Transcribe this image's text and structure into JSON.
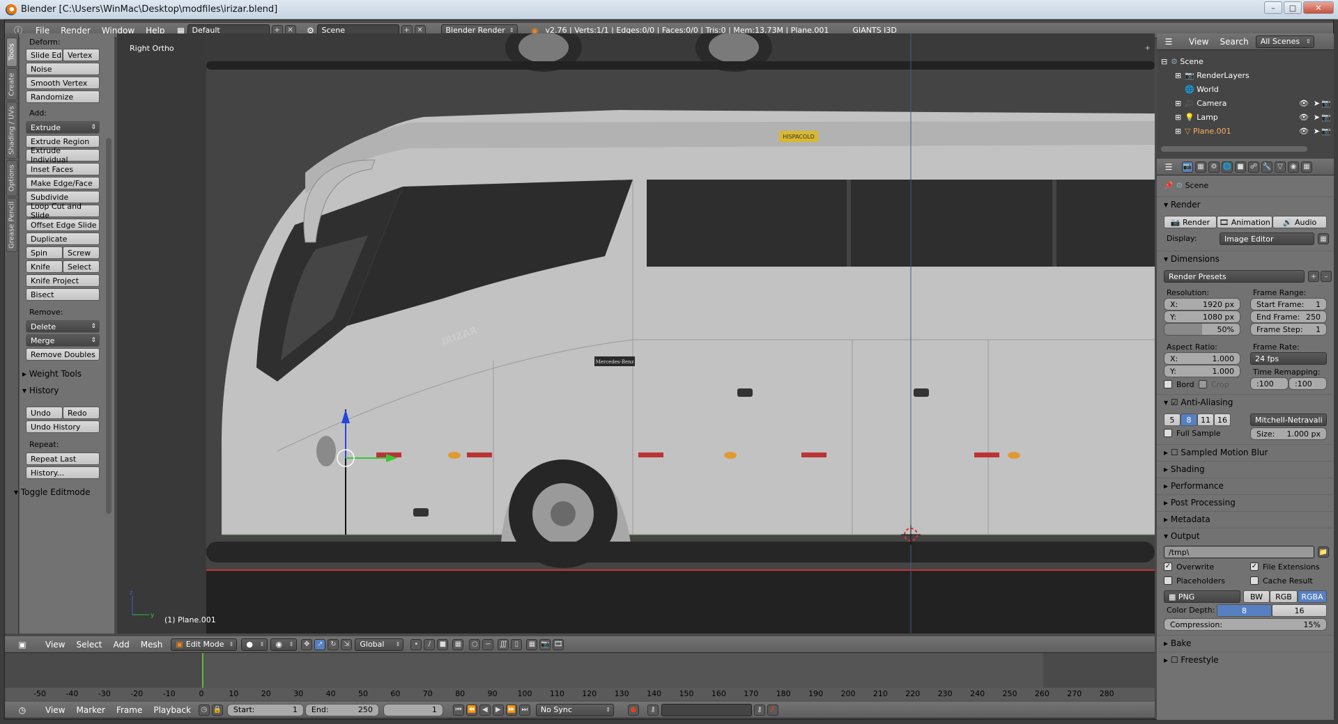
{
  "window": {
    "title": "Blender [C:\\Users\\WinMac\\Desktop\\modfiles\\irizar.blend]"
  },
  "topbar": {
    "menus": [
      "File",
      "Render",
      "Window",
      "Help"
    ],
    "screen_layout": "Default",
    "scene": "Scene",
    "engine": "Blender Render",
    "stats": "v2.76 | Verts:1/1 | Edges:0/0 | Faces:0/0 | Tris:0 | Mem:13.73M | Plane.001",
    "addon": "GIANTS I3D"
  },
  "toolshelf": {
    "tabs": [
      "Tools",
      "Create",
      "Shading / UVs",
      "Options",
      "Grease Pencil"
    ],
    "deform_label": "Deform:",
    "deform": [
      "Slide Ed",
      "Vertex",
      "Noise",
      "Smooth Vertex",
      "Randomize"
    ],
    "add_label": "Add:",
    "extrude": "Extrude",
    "add": [
      "Extrude Region",
      "Extrude Individual",
      "Inset Faces",
      "Make Edge/Face",
      "Subdivide",
      "Loop Cut and Slide",
      "Offset Edge Slide",
      "Duplicate"
    ],
    "spin": "Spin",
    "screw": "Screw",
    "knife": "Knife",
    "select": "Select",
    "knife_project": "Knife Project",
    "bisect": "Bisect",
    "remove_label": "Remove:",
    "delete": "Delete",
    "merge": "Merge",
    "remove_doubles": "Remove Doubles",
    "weight_tools": "Weight Tools",
    "history": "History",
    "undo": "Undo",
    "redo": "Redo",
    "undo_history": "Undo History",
    "repeat_label": "Repeat:",
    "repeat_last": "Repeat Last",
    "history_dots": "History...",
    "toggle_editmode": "Toggle Editmode"
  },
  "viewport": {
    "view_name": "Right Ortho",
    "object_label": "(1) Plane.001",
    "decal_brand": "IRIZAR",
    "badge_text": "Mercedes-Benz",
    "plate_text": "HISPACOLD",
    "colors": {
      "body": "#c2c2c2",
      "window": "#2e2e2e",
      "bg": "#393939"
    }
  },
  "view3d_header": {
    "menus": [
      "View",
      "Select",
      "Add",
      "Mesh"
    ],
    "mode": "Edit Mode",
    "orientation": "Global"
  },
  "timeline": {
    "ticks": [
      "-50",
      "-40",
      "-30",
      "-20",
      "-10",
      "0",
      "10",
      "20",
      "30",
      "40",
      "50",
      "60",
      "70",
      "80",
      "90",
      "100",
      "110",
      "120",
      "130",
      "140",
      "150",
      "160",
      "170",
      "180",
      "190",
      "200",
      "210",
      "220",
      "230",
      "240",
      "250",
      "260",
      "270",
      "280"
    ],
    "current_frame": "0",
    "menus": [
      "View",
      "Marker",
      "Frame",
      "Playback"
    ],
    "start_label": "Start:",
    "start": "1",
    "end_label": "End:",
    "end": "250",
    "frame": "1",
    "sync": "No Sync"
  },
  "outliner": {
    "menus": [
      "View",
      "Search"
    ],
    "filter": "All Scenes",
    "items": [
      "Scene",
      "RenderLayers",
      "World",
      "Camera",
      "Lamp",
      "Plane.001"
    ]
  },
  "properties": {
    "context": "Scene",
    "render_panel": "Render",
    "render_btn": "Render",
    "animation_btn": "Animation",
    "audio_btn": "Audio",
    "display_label": "Display:",
    "display": "Image Editor",
    "dimensions": "Dimensions",
    "render_presets": "Render Presets",
    "resolution_label": "Resolution:",
    "res_x_label": "X:",
    "res_x": "1920 px",
    "res_y_label": "Y:",
    "res_y": "1080 px",
    "res_pct": "50%",
    "frame_range_label": "Frame Range:",
    "start_frame_label": "Start Frame:",
    "start_frame": "1",
    "end_frame_label": "End Frame:",
    "end_frame": "250",
    "frame_step_label": "Frame Step:",
    "frame_step": "1",
    "aspect_label": "Aspect Ratio:",
    "asp_x_label": "X:",
    "asp_x": "1.000",
    "asp_y_label": "Y:",
    "asp_y": "1.000",
    "frame_rate_label": "Frame Rate:",
    "frame_rate": "24 fps",
    "time_remap_label": "Time Remapping:",
    "remap_old": ":100",
    "remap_new": ":100",
    "bord": "Bord",
    "crop": "Crop",
    "anti_aliasing": "Anti-Aliasing",
    "aa_samples": [
      "5",
      "8",
      "11",
      "16"
    ],
    "aa_filter": "Mitchell-Netravali",
    "full_sample": "Full Sample",
    "size_label": "Size:",
    "size": "1.000 px",
    "sampled_motion_blur": "Sampled Motion Blur",
    "shading": "Shading",
    "performance": "Performance",
    "post_processing": "Post Processing",
    "metadata": "Metadata",
    "output": "Output",
    "output_path": "/tmp\\",
    "overwrite": "Overwrite",
    "file_extensions": "File Extensions",
    "placeholders": "Placeholders",
    "cache_result": "Cache Result",
    "format": "PNG",
    "bw": "BW",
    "rgb": "RGB",
    "rgba": "RGBA",
    "color_depth_label": "Color Depth:",
    "depth_8": "8",
    "depth_16": "16",
    "compression_label": "Compression:",
    "compression": "15%",
    "bake": "Bake",
    "freestyle": "Freestyle",
    "accent": "#5680c2"
  }
}
